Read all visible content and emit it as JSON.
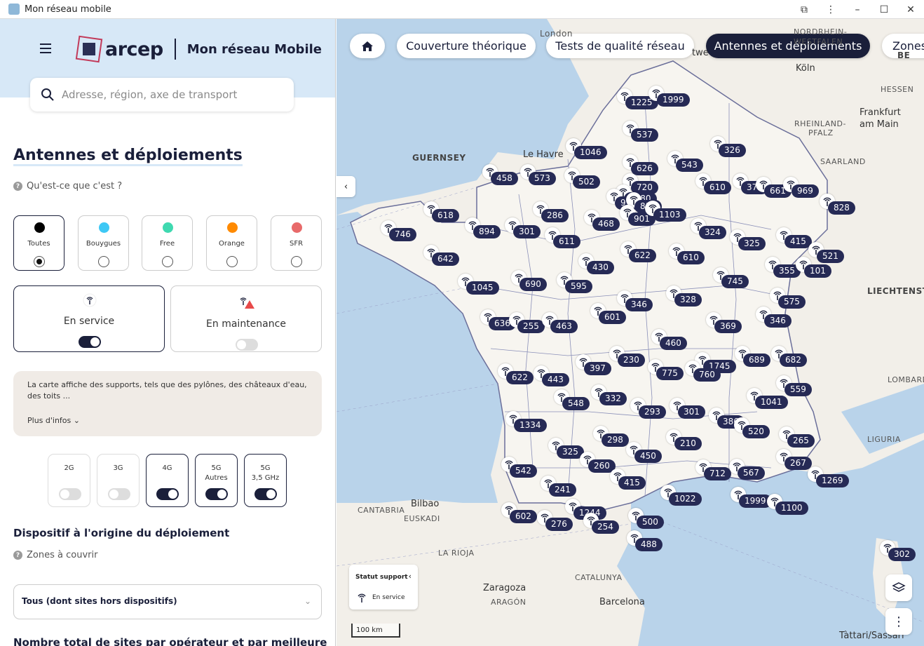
{
  "window": {
    "title": "Mon réseau mobile"
  },
  "header": {
    "logo_text": "arcep",
    "site_name": "Mon réseau Mobile",
    "search_placeholder": "Adresse, région, axe de transport"
  },
  "section": {
    "title": "Antennes et déploiements",
    "help": "Qu'est-ce que c'est ?"
  },
  "operators": [
    {
      "label": "Toutes",
      "color": "#000000",
      "selected": true
    },
    {
      "label": "Bouygues",
      "color": "#3ec8f5",
      "selected": false
    },
    {
      "label": "Free",
      "color": "#3fd9b0",
      "selected": false
    },
    {
      "label": "Orange",
      "color": "#ff8a00",
      "selected": false
    },
    {
      "label": "SFR",
      "color": "#e86a6a",
      "selected": false
    }
  ],
  "status": {
    "in_service": {
      "label": "En service",
      "on": true
    },
    "maintenance": {
      "label": "En maintenance",
      "on": false
    }
  },
  "info": {
    "text": "La carte affiche des supports, tels que des pylônes, des châteaux d'eau, des toits ...",
    "more": "Plus d'infos"
  },
  "technologies": [
    {
      "line1": "2G",
      "line2": "",
      "on": false
    },
    {
      "line1": "3G",
      "line2": "",
      "on": false
    },
    {
      "line1": "4G",
      "line2": "",
      "on": true
    },
    {
      "line1": "5G",
      "line2": "Autres",
      "on": true
    },
    {
      "line1": "5G",
      "line2": "3,5 GHz",
      "on": true
    }
  ],
  "device": {
    "title": "Dispositif à l'origine du déploiement",
    "help": "Zones à couvrir",
    "select_value": "Tous (dont sites hors dispositifs)"
  },
  "bottom_title": "Nombre total de sites par opérateur et par meilleure",
  "map": {
    "tabs": [
      "Couverture théorique",
      "Tests de qualité réseau",
      "Antennes et déploiements",
      "Zones"
    ],
    "active_tab": "Antennes et déploiements",
    "labels": [
      "London",
      "NORDRHEIN-",
      "WESTFALEN",
      "Köln",
      "HESSEN",
      "Frankfurt",
      "am Main",
      "RHEINLAND-",
      "PFALZ",
      "SAARLAND",
      "GUERNSEY",
      "Le Havre",
      "LIECHTENSTEIN",
      "LOMBARD",
      "LIGURIA",
      "CANTABRIA",
      "Bilbao",
      "EUSKADI",
      "LA RIOJA",
      "CATALUNYA",
      "Zaragoza",
      "ARAGÓN",
      "Barcelona",
      "Tàttari/Sassari",
      "BE",
      "twe"
    ],
    "counts": [
      "1225",
      "1999",
      "537",
      "1046",
      "626",
      "543",
      "326",
      "458",
      "573",
      "502",
      "720",
      "1080",
      "977",
      "816",
      "610",
      "374",
      "661",
      "969",
      "828",
      "618",
      "286",
      "468",
      "901",
      "1103",
      "746",
      "894",
      "301",
      "611",
      "324",
      "325",
      "415",
      "521",
      "642",
      "622",
      "610",
      "430",
      "355",
      "101",
      "1045",
      "690",
      "595",
      "745",
      "575",
      "346",
      "328",
      "636",
      "255",
      "601",
      "369",
      "346",
      "463",
      "460",
      "689",
      "682",
      "1745",
      "230",
      "397",
      "775",
      "760",
      "622",
      "443",
      "559",
      "332",
      "1041",
      "548",
      "293",
      "301",
      "386",
      "520",
      "1334",
      "298",
      "210",
      "265",
      "325",
      "450",
      "260",
      "712",
      "567",
      "267",
      "542",
      "415",
      "1269",
      "241",
      "1022",
      "1999",
      "1100",
      "1244",
      "602",
      "276",
      "500",
      "254",
      "488",
      "302"
    ],
    "legend": {
      "title": "Statut support",
      "entry": "En service"
    },
    "scale": "100 km"
  }
}
